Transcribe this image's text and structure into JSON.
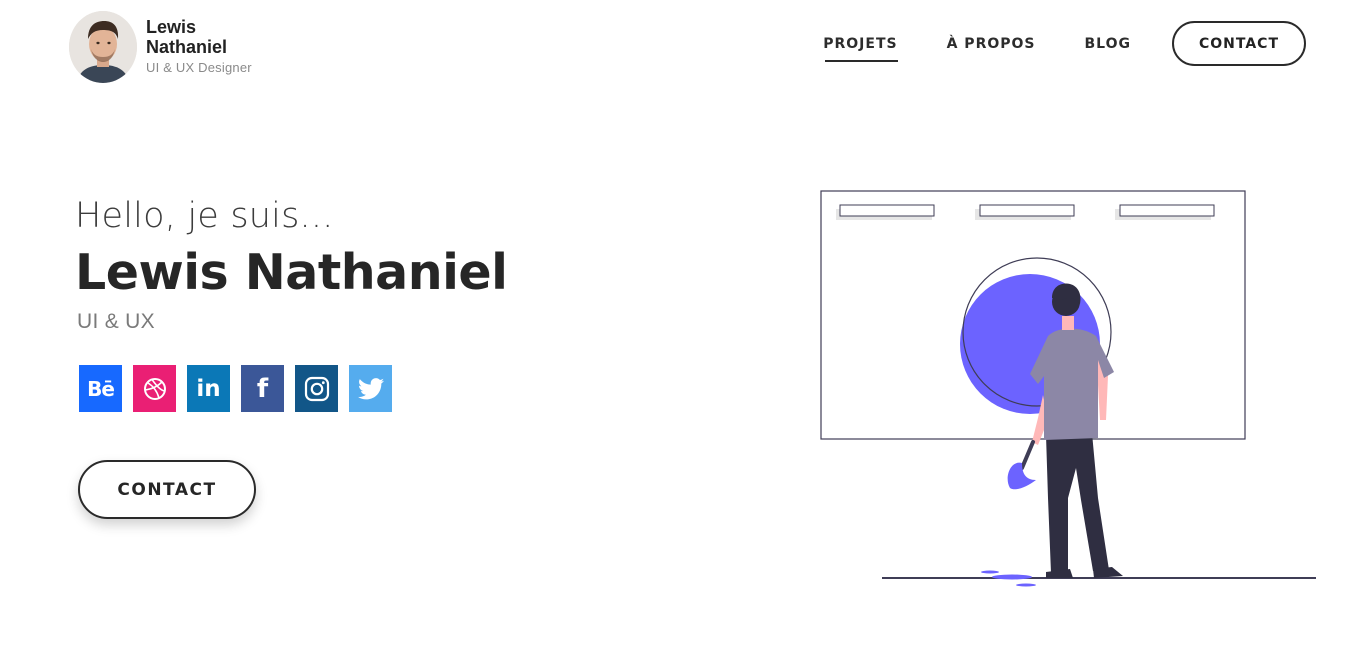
{
  "brand": {
    "first_name": "Lewis",
    "last_name": "Nathaniel",
    "role": "UI & UX Designer"
  },
  "nav": {
    "items": [
      {
        "label": "PROJETS",
        "active": true
      },
      {
        "label": "À PROPOS",
        "active": false
      },
      {
        "label": "BLOG",
        "active": false
      }
    ],
    "contact_label": "CONTACT"
  },
  "hero": {
    "greeting": "Hello, je suis...",
    "name": "Lewis Nathaniel",
    "subtitle": "UI & UX",
    "cta_label": "CONTACT"
  },
  "socials": [
    {
      "name": "behance",
      "icon": "behance-icon",
      "glyph": "Bē",
      "color": "#1769ff"
    },
    {
      "name": "dribbble",
      "icon": "dribbble-icon",
      "glyph": "",
      "color": "#ea1f74"
    },
    {
      "name": "linkedin",
      "icon": "linkedin-icon",
      "glyph": "in",
      "color": "#0b78b7"
    },
    {
      "name": "facebook",
      "icon": "facebook-icon",
      "glyph": "f",
      "color": "#3b5798"
    },
    {
      "name": "instagram",
      "icon": "instagram-icon",
      "glyph": "",
      "color": "#125688"
    },
    {
      "name": "twitter",
      "icon": "twitter-icon",
      "glyph": "",
      "color": "#55acee"
    }
  ],
  "colors": {
    "accent": "#6c63ff",
    "text": "#262626",
    "figure_shirt": "#8c87a6",
    "figure_pants": "#2f2e41"
  }
}
